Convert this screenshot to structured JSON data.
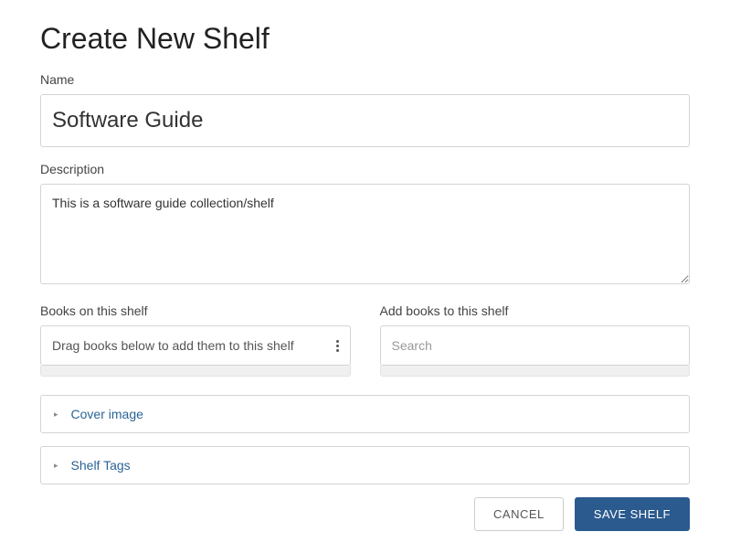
{
  "page": {
    "title": "Create New Shelf"
  },
  "name_field": {
    "label": "Name",
    "value": "Software Guide"
  },
  "description_field": {
    "label": "Description",
    "value": "This is a software guide collection/shelf"
  },
  "books_on_shelf": {
    "label": "Books on this shelf",
    "hint": "Drag books below to add them to this shelf"
  },
  "add_books": {
    "label": "Add books to this shelf",
    "placeholder": "Search"
  },
  "collapsibles": {
    "cover_image": "Cover image",
    "shelf_tags": "Shelf Tags"
  },
  "buttons": {
    "cancel": "CANCEL",
    "save": "SAVE SHELF"
  }
}
